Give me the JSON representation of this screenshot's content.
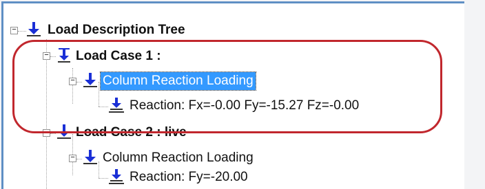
{
  "tree": {
    "root": {
      "label": "Load Description Tree",
      "toggle": "−"
    },
    "case1": {
      "label": "Load Case 1 :",
      "toggle": "−"
    },
    "case1_loading": {
      "label": "Column Reaction Loading",
      "toggle": "−"
    },
    "case1_reaction": {
      "label": "Reaction: Fx=-0.00 Fy=-15.27 Fz=-0.00"
    },
    "case2": {
      "label": "Load Case 2 : live",
      "toggle": "−"
    },
    "case2_loading": {
      "label": "Column Reaction Loading",
      "toggle": "−"
    },
    "case2_reaction": {
      "label": "Reaction: Fy=-20.00"
    }
  },
  "icons": {
    "root": "arrow-down-icon",
    "case1": "load-case-icon",
    "loading": "arrow-down-icon",
    "reaction": "reaction-support-icon"
  },
  "colors": {
    "selection": "#3399ff",
    "highlight_ring": "#c1272d",
    "icon_blue": "#1a2fd6"
  }
}
